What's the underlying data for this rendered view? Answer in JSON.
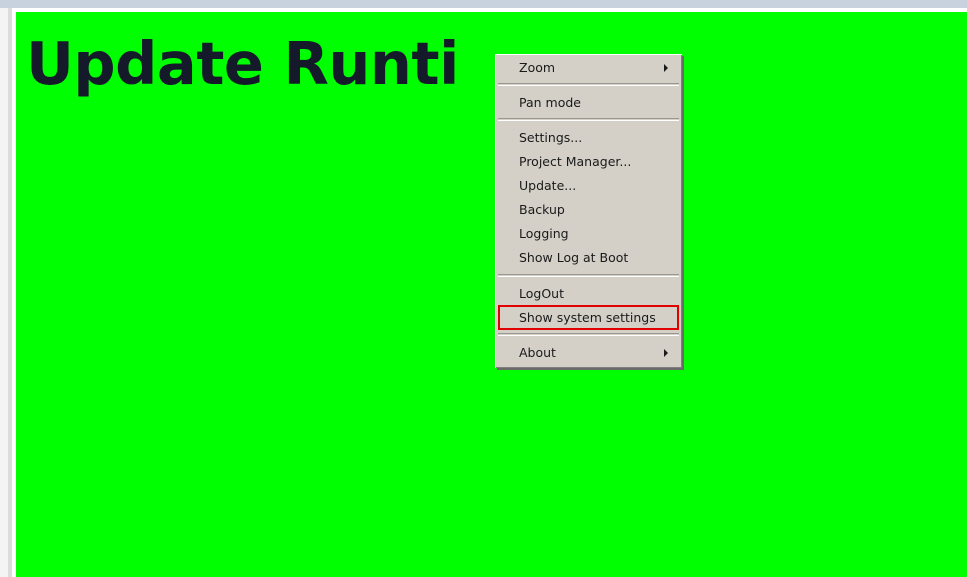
{
  "page": {
    "title": "Update Runti",
    "background_color": "#00ff00"
  },
  "context_menu": {
    "items": [
      {
        "label": "Zoom",
        "has_submenu": true
      },
      {
        "label": "Pan mode"
      },
      {
        "label": "Settings..."
      },
      {
        "label": "Project Manager..."
      },
      {
        "label": "Update..."
      },
      {
        "label": "Backup"
      },
      {
        "label": "Logging"
      },
      {
        "label": "Show Log at Boot"
      },
      {
        "label": "LogOut"
      },
      {
        "label": "Show system settings",
        "highlighted": true,
        "highlight_color": "#e00000"
      },
      {
        "label": "About",
        "has_submenu": true
      }
    ]
  }
}
